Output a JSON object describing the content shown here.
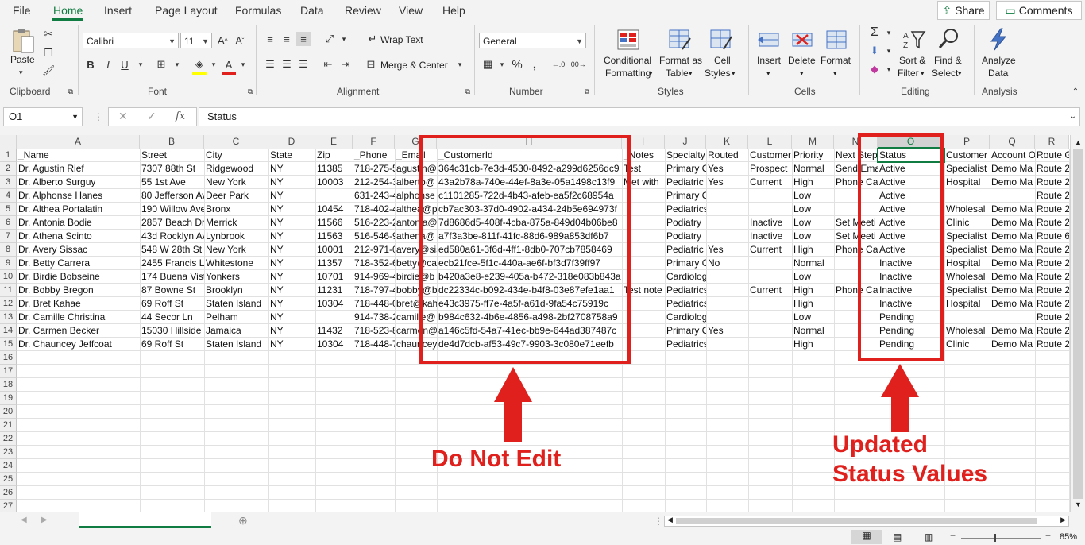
{
  "menu": [
    "File",
    "Home",
    "Insert",
    "Page Layout",
    "Formulas",
    "Data",
    "Review",
    "View",
    "Help"
  ],
  "share_label": "Share",
  "comments_label": "Comments",
  "ribbon": {
    "paste": "Paste",
    "clipboard": "Clipboard",
    "font_name": "Calibri",
    "font_size": "11",
    "font": "Font",
    "alignment": "Alignment",
    "wrap_text": "Wrap Text",
    "merge_center": "Merge & Center",
    "number_format": "General",
    "number": "Number",
    "cond_format_1": "Conditional",
    "cond_format_2": "Formatting",
    "format_table_1": "Format as",
    "format_table_2": "Table",
    "cell_styles_1": "Cell",
    "cell_styles_2": "Styles",
    "styles": "Styles",
    "insert": "Insert",
    "delete": "Delete",
    "format": "Format",
    "cells": "Cells",
    "sort_filter_1": "Sort &",
    "sort_filter_2": "Filter",
    "find_select_1": "Find &",
    "find_select_2": "Select",
    "editing": "Editing",
    "analyze_1": "Analyze",
    "analyze_2": "Data",
    "analysis": "Analysis"
  },
  "name_box": "O1",
  "formula_value": "Status",
  "columns": [
    "A",
    "B",
    "C",
    "D",
    "E",
    "F",
    "G",
    "H",
    "I",
    "J",
    "K",
    "L",
    "M",
    "N",
    "O",
    "P",
    "Q",
    "R"
  ],
  "row_numbers": [
    "1",
    "2",
    "3",
    "4",
    "5",
    "6",
    "7",
    "8",
    "9",
    "10",
    "11",
    "12",
    "13",
    "14",
    "15",
    "16",
    "17",
    "18",
    "19",
    "20",
    "21",
    "22",
    "23",
    "24",
    "25",
    "26",
    "27"
  ],
  "rows": [
    [
      "_Name",
      "Street",
      "City",
      "State",
      "Zip",
      "_Phone",
      "_Email",
      "_CustomerId",
      "_Notes",
      "Specialty",
      "Routed",
      "Customer",
      "Priority",
      "Next Step",
      "Status",
      "Customer",
      "Account O",
      "Route G"
    ],
    [
      "Dr. Agustin Rief",
      "7307 88th St",
      "Ridgewood",
      "NY",
      "11385",
      "718-275-5",
      "agustin@",
      "364c31cb-7e3d-4530-8492-a299d6256dc9",
      "Test",
      "Primary C",
      "Yes",
      "Prospect",
      "Normal",
      "Send Ema",
      "Active",
      "Specialist",
      "Demo Ma",
      "Route 2"
    ],
    [
      "Dr. Alberto Surguy",
      "55 1st Ave",
      "New York",
      "NY",
      "10003",
      "212-254-3",
      "alberto@",
      "43a2b78a-740e-44ef-8a3e-05a1498c13f9",
      "Met with",
      "Pediatric",
      "Yes",
      "Current",
      "High",
      "Phone Ca",
      "Active",
      "Hospital",
      "Demo Ma",
      "Route 2"
    ],
    [
      "Dr. Alphonse Hanes",
      "80 Jefferson Av",
      "Deer Park",
      "NY",
      "",
      "631-243-4",
      "alphonse",
      "c1101285-722d-4b43-afeb-ea5f2c68954a",
      "",
      "Primary Care",
      "",
      "",
      "Low",
      "",
      "Active",
      "",
      "",
      "Route 2"
    ],
    [
      "Dr. Althea Portalatin",
      "190 Willow Ave",
      "Bronx",
      "NY",
      "10454",
      "718-402-4",
      "althea@p",
      "cb7ac303-37d0-4902-a434-24b5e694973f",
      "",
      "Pediatrics",
      "",
      "",
      "Low",
      "",
      "Active",
      "Wholesal",
      "Demo Ma",
      "Route 2"
    ],
    [
      "Dr. Antonia Bodie",
      "2857 Beach Dr",
      "Merrick",
      "NY",
      "11566",
      "516-223-2",
      "antonia@",
      "7d8686d5-408f-4cba-875a-849d04b06be8",
      "",
      "Podiatry",
      "",
      "Inactive",
      "Low",
      "Set Meeti",
      "Active",
      "Clinic",
      "Demo Ma",
      "Route 2"
    ],
    [
      "Dr. Athena Scinto",
      "43d Rocklyn Av",
      "Lynbrook",
      "NY",
      "11563",
      "516-546-9",
      "athena@",
      "a7f3a3be-811f-41fc-88d6-989a853df6b7",
      "",
      "Podiatry",
      "",
      "Inactive",
      "Low",
      "Set Meeti",
      "Active",
      "Specialist",
      "Demo Ma",
      "Route 6"
    ],
    [
      "Dr. Avery Sissac",
      "548 W 28th St",
      "New York",
      "NY",
      "10001",
      "212-971-0",
      "avery@sis",
      "ed580a61-3f6d-4ff1-8db0-707cb7858469",
      "",
      "Pediatric",
      "Yes",
      "Current",
      "High",
      "Phone Ca",
      "Active",
      "Specialist",
      "Demo Ma",
      "Route 2"
    ],
    [
      "Dr. Betty Carrera",
      "2455 Francis La",
      "Whitestone",
      "NY",
      "11357",
      "718-352-6",
      "betty@ca",
      "ecb21fce-5f1c-440a-ae6f-bf3d7f39ff97",
      "",
      "Primary C",
      "No",
      "",
      "Normal",
      "",
      "Inactive",
      "Hospital",
      "Demo Ma",
      "Route 2"
    ],
    [
      "Dr. Birdie Bobseine",
      "174 Buena Vist",
      "Yonkers",
      "NY",
      "10701",
      "914-969-4",
      "birdie@b",
      "b420a3e8-e239-405a-b472-318e083b843a",
      "",
      "Cardiology",
      "",
      "",
      "Low",
      "",
      "Inactive",
      "Wholesal",
      "Demo Ma",
      "Route 2"
    ],
    [
      "Dr. Bobby Bregon",
      "87 Bowne St",
      "Brooklyn",
      "NY",
      "11231",
      "718-797-4",
      "bobby@b",
      "dc22334c-b092-434e-b4f8-03e87efe1aa1",
      "Test note",
      "Pediatrics",
      "",
      "Current",
      "High",
      "Phone Ca",
      "Inactive",
      "Specialist",
      "Demo Ma",
      "Route 2"
    ],
    [
      "Dr. Bret Kahae",
      "69 Roff St",
      "Staten Island",
      "NY",
      "10304",
      "718-448-0",
      "bret@kah",
      "e43c3975-ff7e-4a5f-a61d-9fa54c75919c",
      "",
      "Pediatrics",
      "",
      "",
      "High",
      "",
      "Inactive",
      "Hospital",
      "Demo Ma",
      "Route 2"
    ],
    [
      "Dr. Camille Christina",
      "44 Secor Ln",
      "Pelham",
      "NY",
      "",
      "914-738-2",
      "camille@",
      "b984c632-4b6e-4856-a498-2bf2708758a9",
      "",
      "Cardiology",
      "",
      "",
      "Low",
      "",
      "Pending",
      "",
      "",
      "Route 2"
    ],
    [
      "Dr. Carmen Becker",
      "15030 Hillside",
      "Jamaica",
      "NY",
      "11432",
      "718-523-8",
      "carmen@",
      "a146c5fd-54a7-41ec-bb9e-644ad387487c",
      "",
      "Primary C",
      "Yes",
      "",
      "Normal",
      "",
      "Pending",
      "Wholesal",
      "Demo Ma",
      "Route 2"
    ],
    [
      "Dr. Chauncey Jeffcoat",
      "69 Roff St",
      "Staten Island",
      "NY",
      "10304",
      "718-448-7",
      "chauncey",
      "de4d7dcb-af53-49c7-9903-3c080e71eefb",
      "",
      "Pediatrics",
      "",
      "",
      "High",
      "",
      "Pending",
      "Clinic",
      "Demo Ma",
      "Route 2"
    ]
  ],
  "annotations": {
    "do_not_edit": "Do Not Edit",
    "updated_1": "Updated",
    "updated_2": "Status Values"
  },
  "zoom": "85%",
  "colors": {
    "accent": "#107c41",
    "annotation": "#e0201c"
  }
}
